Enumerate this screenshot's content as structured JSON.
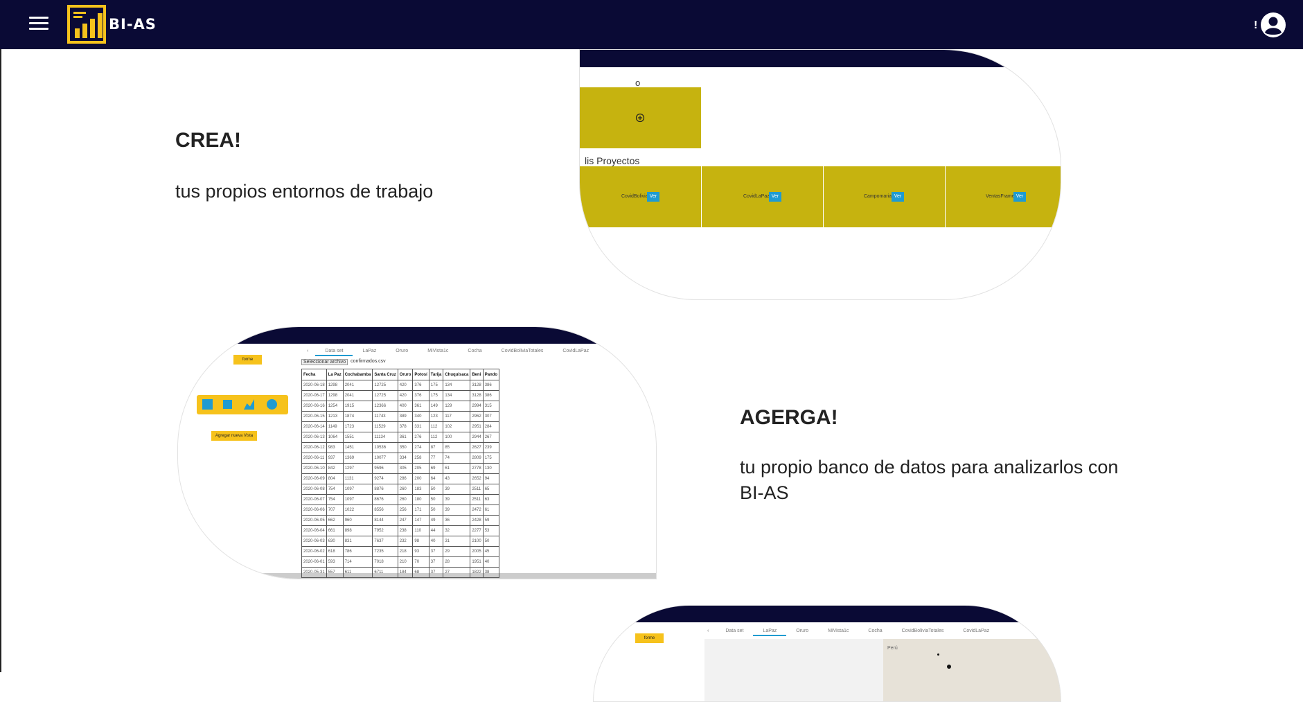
{
  "header": {
    "brand": "BI-AS",
    "notice": "!"
  },
  "sections": [
    {
      "title": "CREA!",
      "text": "tus propios entornos de trabajo"
    },
    {
      "title": "AGERGA!",
      "text": "tu propio banco de datos para analizarlos con BI-AS"
    }
  ],
  "shot1": {
    "top_label": "o",
    "projects_label": "lis Proyectos",
    "projects": [
      "CovidBolivia",
      "CovidLaPaz",
      "Campomaria",
      "VentasFrame"
    ],
    "ver_label": "Ver"
  },
  "shot2": {
    "corner": "Jo",
    "informe_btn": "forme",
    "add_view_btn": "Agregar nueva Vista",
    "tabs": [
      "Data set",
      "LaPaz",
      "Oruro",
      "MiVista1c",
      "Cocha",
      "CovidBoliviaTotales",
      "CovidLaPaz"
    ],
    "select_file_label": "Seleccionar archivo",
    "file_name": "confirmados.csv",
    "columns": [
      "Fecha",
      "La Paz",
      "Cochabamba",
      "Santa Cruz",
      "Oruro",
      "Potosí",
      "Tarija",
      "Chuquisaca",
      "Beni",
      "Pando"
    ],
    "rows": [
      [
        "2020-06-18",
        "1298",
        "2041",
        "12725",
        "420",
        "376",
        "175",
        "134",
        "3128",
        "386"
      ],
      [
        "2020-06-17",
        "1298",
        "2041",
        "12725",
        "420",
        "376",
        "175",
        "134",
        "3128",
        "386"
      ],
      [
        "2020-06-16",
        "1254",
        "1915",
        "12366",
        "400",
        "361",
        "149",
        "129",
        "2994",
        "315"
      ],
      [
        "2020-06-15",
        "1213",
        "1874",
        "11743",
        "389",
        "340",
        "123",
        "117",
        "2962",
        "307"
      ],
      [
        "2020-06-14",
        "1149",
        "1723",
        "11529",
        "378",
        "331",
        "112",
        "102",
        "2951",
        "284"
      ],
      [
        "2020-06-13",
        "1064",
        "1551",
        "11134",
        "361",
        "276",
        "112",
        "100",
        "2944",
        "267"
      ],
      [
        "2020-06-12",
        "983",
        "1451",
        "10536",
        "350",
        "274",
        "87",
        "85",
        "2627",
        "239"
      ],
      [
        "2020-06-11",
        "937",
        "1369",
        "10077",
        "334",
        "258",
        "77",
        "74",
        "2809",
        "175"
      ],
      [
        "2020-06-10",
        "842",
        "1297",
        "9596",
        "305",
        "205",
        "69",
        "61",
        "2778",
        "130"
      ],
      [
        "2020-06-09",
        "804",
        "1131",
        "9274",
        "286",
        "200",
        "64",
        "43",
        "2652",
        "94"
      ],
      [
        "2020-06-08",
        "754",
        "1097",
        "8876",
        "260",
        "183",
        "50",
        "39",
        "2511",
        "65"
      ],
      [
        "2020-06-07",
        "754",
        "1097",
        "8676",
        "260",
        "180",
        "50",
        "39",
        "2511",
        "63"
      ],
      [
        "2020-06-06",
        "707",
        "1022",
        "8556",
        "256",
        "171",
        "50",
        "39",
        "2472",
        "61"
      ],
      [
        "2020-06-05",
        "662",
        "960",
        "8144",
        "247",
        "147",
        "49",
        "36",
        "2428",
        "59"
      ],
      [
        "2020-06-04",
        "661",
        "898",
        "7952",
        "238",
        "110",
        "44",
        "32",
        "2277",
        "53"
      ],
      [
        "2020-06-03",
        "630",
        "831",
        "7637",
        "232",
        "98",
        "40",
        "31",
        "2100",
        "50"
      ],
      [
        "2020-06-02",
        "618",
        "786",
        "7235",
        "218",
        "93",
        "37",
        "29",
        "2005",
        "45"
      ],
      [
        "2020-06-01",
        "593",
        "714",
        "7018",
        "210",
        "70",
        "37",
        "28",
        "1951",
        "40"
      ],
      [
        "2020-05-31",
        "557",
        "611",
        "6711",
        "184",
        "68",
        "37",
        "27",
        "1822",
        "38"
      ]
    ]
  },
  "shot3": {
    "corner": "Jo",
    "informe_btn": "forme",
    "tabs": [
      "Data set",
      "LaPaz",
      "Oruro",
      "MiVista1c",
      "Cocha",
      "CovidBoliviaTotales",
      "CovidLaPaz"
    ],
    "map_label": "Perú"
  },
  "colors": {
    "navy": "#0a0a35",
    "olive": "#c6b30f",
    "amber": "#f6c21c",
    "blue": "#1f9bd1"
  }
}
